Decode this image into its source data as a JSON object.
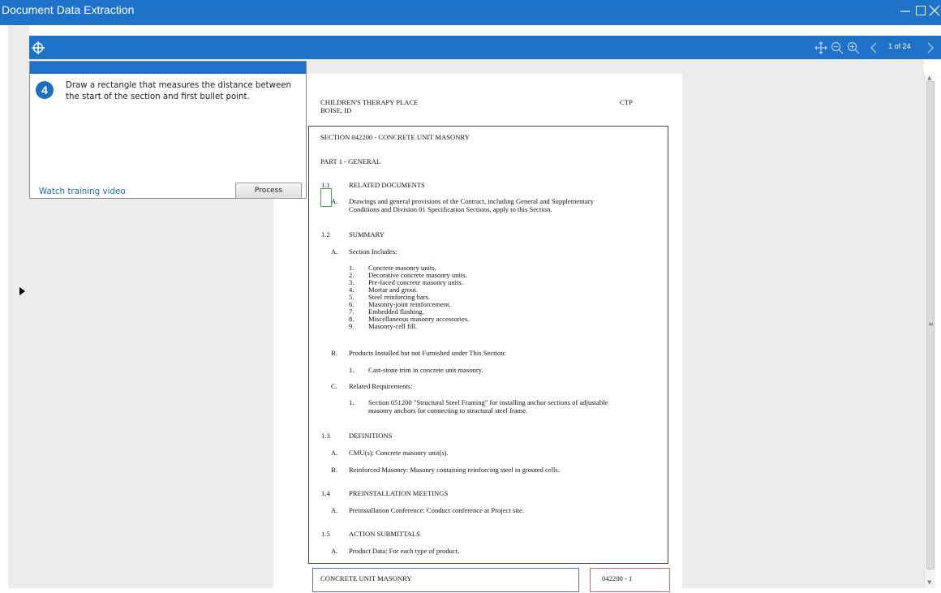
{
  "window": {
    "title": "Document Data Extraction",
    "controls": [
      "minimize-icon",
      "maximize-icon",
      "close-icon"
    ]
  },
  "toolbar": {
    "icons": [
      "target-icon",
      "pan-icon",
      "zoom-out-icon",
      "zoom-in-icon",
      "chevron-left-icon",
      "chevron-right-icon"
    ],
    "page_indicator": "1 of 24"
  },
  "instruction": {
    "step": "4",
    "text": "Draw a rectangle that measures the distance between the start of the section and first bullet point.",
    "watch_link": "Watch training video",
    "process_label": "Process"
  },
  "colors": {
    "accent": "#1f72c9",
    "viewer_bg": "#ececec",
    "selection": "#3aa84a",
    "footer_left_box": "#5b6bd6",
    "footer_right_box": "#d86464"
  },
  "document": {
    "header_left": [
      "CHILDREN'S THERAPY PLACE",
      "BOISE, ID"
    ],
    "header_right": "CTP",
    "section_title": "SECTION 042200 - CONCRETE UNIT MASONRY",
    "part": "PART 1 - GENERAL",
    "s11_num": "1.1",
    "s11_title": "RELATED DOCUMENTS",
    "s11_a_label": "A.",
    "s11_a_text": [
      "Drawings and general provisions of the Contract, including General and Supplementary",
      "Conditions and Division 01 Specification Sections, apply to this Section."
    ],
    "s12_num": "1.2",
    "s12_title": "SUMMARY",
    "s12_a_label": "A.",
    "s12_a_text": "Section Includes:",
    "s12_a_items": [
      {
        "n": "1.",
        "t": "Concrete masonry units."
      },
      {
        "n": "2.",
        "t": "Decorative concrete masonry units."
      },
      {
        "n": "3.",
        "t": "Pre-faced concrete masonry units."
      },
      {
        "n": "4.",
        "t": "Mortar and grout."
      },
      {
        "n": "5.",
        "t": "Steel reinforcing bars."
      },
      {
        "n": "6.",
        "t": "Masonry-joint reinforcement."
      },
      {
        "n": "7.",
        "t": "Embedded flashing."
      },
      {
        "n": "8.",
        "t": "Miscellaneous masonry accessories."
      },
      {
        "n": "9.",
        "t": "Masonry-cell fill."
      }
    ],
    "s12_b_label": "B.",
    "s12_b_text": "Products Installed but not Furnished under This Section:",
    "s12_b_item_n": "1.",
    "s12_b_item_t": "Cast-stone trim in concrete unit masonry.",
    "s12_c_label": "C.",
    "s12_c_text": "Related Requirements:",
    "s12_c_item_n": "1.",
    "s12_c_item_t": [
      "Section 051200 \"Structural Steel Framing\" for installing anchor sections of adjustable",
      "masonry anchors for connecting to structural steel frame."
    ],
    "s13_num": "1.3",
    "s13_title": "DEFINITIONS",
    "s13_a_label": "A.",
    "s13_a_text": "CMU(s): Concrete masonry unit(s).",
    "s13_b_label": "B.",
    "s13_b_text": "Reinforced Masonry: Masonry containing reinforcing steel in grouted cells.",
    "s14_num": "1.4",
    "s14_title": "PREINSTALLATION MEETINGS",
    "s14_a_label": "A.",
    "s14_a_text": "Preinstallation Conference: Conduct conference at Project site.",
    "s15_num": "1.5",
    "s15_title": "ACTION SUBMITTALS",
    "s15_a_label": "A.",
    "s15_a_text": "Product Data: For each type of product.",
    "footer_left": "CONCRETE UNIT MASONRY",
    "footer_right": "042200 - 1"
  }
}
